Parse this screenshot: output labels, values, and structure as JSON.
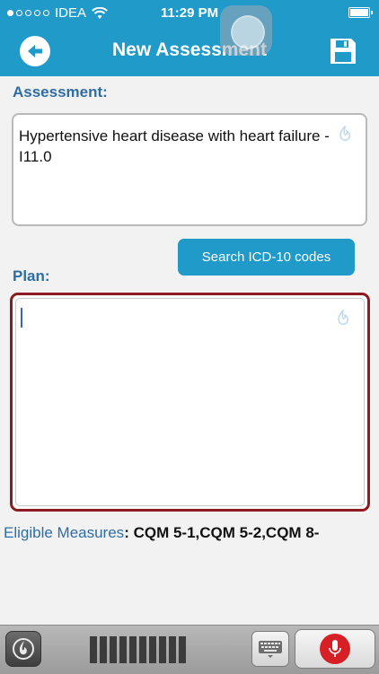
{
  "status_bar": {
    "carrier": "IDEA",
    "time": "11:29 PM",
    "signal_dots_filled": 1,
    "signal_dots_total": 5
  },
  "nav": {
    "title": "New Assessment",
    "back_icon": "back-arrow-icon",
    "save_icon": "save-disk-icon"
  },
  "assessment": {
    "label": "Assessment:",
    "value": "Hypertensive heart disease with heart failure - I11.0"
  },
  "search": {
    "label": "Search ICD-10 codes"
  },
  "plan": {
    "label": "Plan:",
    "value": ""
  },
  "eligible": {
    "label": "Eligible Measures",
    "separator": ": ",
    "value": "CQM 5-1,CQM 5-2,CQM 8-"
  },
  "toolbar": {
    "dragon_icon": "dragon-logo-icon",
    "keyboard_icon": "keyboard-icon",
    "mic_icon": "microphone-icon",
    "level_bars": 10
  },
  "colors": {
    "header": "#1f9ac9",
    "label": "#2e6da4",
    "plan_border": "#8d1b1f",
    "mic": "#d71f26"
  }
}
